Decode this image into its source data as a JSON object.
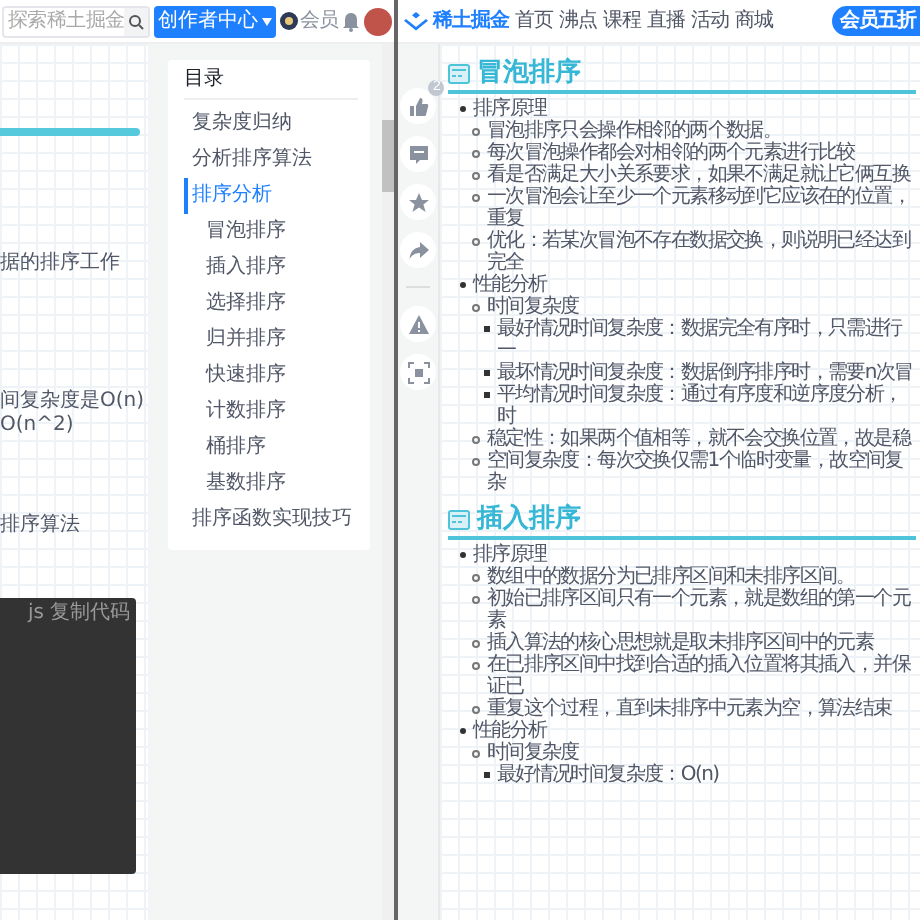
{
  "left_window": {
    "header": {
      "search": {
        "placeholder": "探索稀土掘金"
      },
      "creator_button": "创作者中心",
      "vip_label": "会员"
    },
    "article_fragments": [
      "据的排序工作",
      "间复杂度是O(n)",
      "O(n^2)",
      "排序算法"
    ],
    "code_block": {
      "language": "js",
      "copy_label": "复制代码"
    },
    "toc": {
      "title": "目录",
      "items": [
        {
          "label": "复杂度归纳",
          "selected": false
        },
        {
          "label": "分析排序算法",
          "selected": false
        },
        {
          "label": "排序分析",
          "selected": true,
          "children": [
            {
              "label": "冒泡排序",
              "selected": false
            },
            {
              "label": "插入排序",
              "selected": false
            },
            {
              "label": "选择排序",
              "selected": false
            },
            {
              "label": "归并排序",
              "selected": false
            },
            {
              "label": "快速排序",
              "selected": false
            },
            {
              "label": "计数排序",
              "selected": false
            },
            {
              "label": "桶排序",
              "selected": false
            },
            {
              "label": "基数排序",
              "selected": false
            }
          ]
        },
        {
          "label": "排序函数实现技巧",
          "selected": false
        }
      ]
    }
  },
  "right_window": {
    "brand": "稀土掘金",
    "nav": [
      "首页",
      "沸点",
      "课程",
      "直播",
      "活动",
      "商城"
    ],
    "promo": "会员五折",
    "primary_actions": [
      {
        "kind": "like",
        "badge": "2"
      },
      {
        "kind": "comment"
      },
      {
        "kind": "star"
      },
      {
        "kind": "share"
      }
    ],
    "secondary_actions": [
      {
        "kind": "report"
      },
      {
        "kind": "focus"
      }
    ],
    "sections": [
      {
        "title": "冒泡排序",
        "items": [
          {
            "text": "排序原理",
            "children": [
              {
                "text": "冒泡排序只会操作相邻的两个数据。"
              },
              {
                "text": "每次冒泡操作都会对相邻的两个元素进行比较"
              },
              {
                "text": "看是否满足大小关系要求，如果不满足就让它俩互换"
              },
              {
                "text": "一次冒泡会让至少一个元素移动到它应该在的位置，重复"
              },
              {
                "text": "优化：若某次冒泡不存在数据交换，则说明已经达到完全"
              }
            ]
          },
          {
            "text": "性能分析",
            "children": [
              {
                "text": "时间复杂度",
                "children": [
                  {
                    "text": "最好情况时间复杂度：数据完全有序时，只需进行一"
                  },
                  {
                    "text": "最坏情况时间复杂度：数据倒序排序时，需要n次冒"
                  },
                  {
                    "text": "平均情况时间复杂度：通过有序度和逆序度分析，时"
                  }
                ]
              },
              {
                "text": "稳定性：如果两个值相等，就不会交换位置，故是稳"
              },
              {
                "text": "空间复杂度：每次交换仅需1个临时变量，故空间复杂"
              }
            ]
          }
        ]
      },
      {
        "title": "插入排序",
        "items": [
          {
            "text": "排序原理",
            "children": [
              {
                "text": "数组中的数据分为已排序区间和未排序区间。"
              },
              {
                "text": "初始已排序区间只有一个元素，就是数组的第一个元素"
              },
              {
                "text": "插入算法的核心思想就是取未排序区间中的元素"
              },
              {
                "text": "在已排序区间中找到合适的插入位置将其插入，并保证已"
              },
              {
                "text": "重复这个过程，直到未排序中元素为空，算法结束"
              }
            ]
          },
          {
            "text": "性能分析",
            "children": [
              {
                "text": "时间复杂度",
                "children": [
                  {
                    "text": "最好情况时间复杂度：O(n)"
                  }
                ]
              }
            ]
          }
        ]
      }
    ]
  }
}
